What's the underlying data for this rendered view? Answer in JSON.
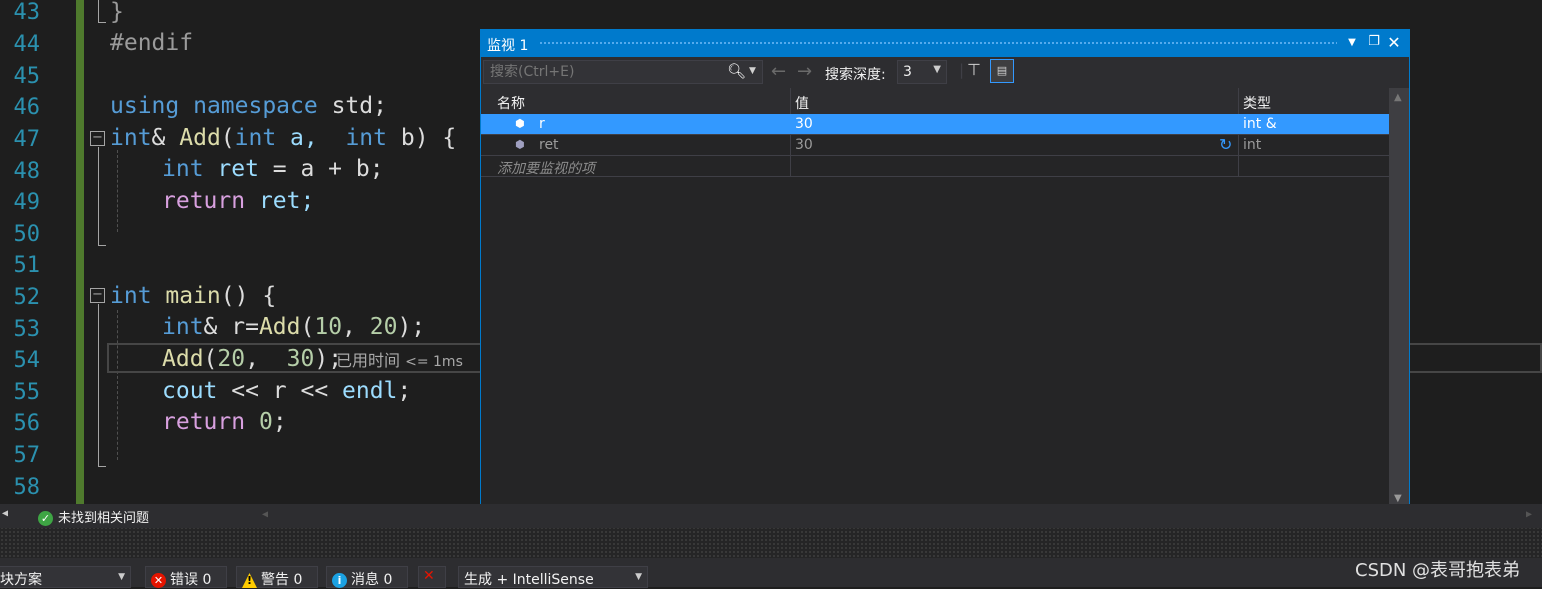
{
  "editor": {
    "line_numbers": [
      "43",
      "44",
      "45",
      "46",
      "47",
      "48",
      "49",
      "50",
      "51",
      "52",
      "53",
      "54",
      "55",
      "56",
      "57",
      "58"
    ],
    "lines": {
      "l43": "}",
      "l44": "#endif",
      "l46": [
        "using",
        " namespace ",
        "std",
        ";"
      ],
      "l47": [
        "int",
        "& ",
        "Add",
        "(",
        "int",
        " a,  ",
        "int",
        " b) {"
      ],
      "l48": [
        "int",
        " ret ",
        "= a + b;"
      ],
      "l49": [
        "return",
        " ret;"
      ],
      "l50": "}",
      "l52": [
        "int",
        " main",
        "() {"
      ],
      "l53": [
        "int",
        "& r=",
        "Add",
        "(",
        "10",
        ", ",
        "20",
        ");"
      ],
      "l54": [
        "Add",
        "(",
        "20",
        ",  ",
        "30",
        ");"
      ],
      "l55": [
        "cout",
        " << r << ",
        "endl",
        ";"
      ],
      "l56": [
        "return",
        " ",
        "0",
        ";"
      ],
      "l57": "}"
    },
    "elapsed_label": "已用时间",
    "elapsed_value": "<= 1ms"
  },
  "watch": {
    "title": "监视 1",
    "search_placeholder": "搜索(Ctrl+E)",
    "depth_label": "搜索深度:",
    "depth_value": "3",
    "columns": [
      "名称",
      "值",
      "类型"
    ],
    "rows": [
      {
        "name": "r",
        "value": "30",
        "type": "int &",
        "selected": true
      },
      {
        "name": "ret",
        "value": "30",
        "type": "int",
        "selected": false
      }
    ],
    "add_item_text": "添加要监视的项"
  },
  "status": {
    "no_issues": "未找到相关问题"
  },
  "errorlist": {
    "solution_label": "块方案",
    "errors": "错误 0",
    "warnings": "警告 0",
    "messages": "消息 0",
    "filter": "生成 + IntelliSense"
  },
  "watermark": "CSDN @表哥抱表弟",
  "colors": {
    "accent": "#007acc",
    "selection": "#3399ff",
    "editor_bg": "#1e1e1e"
  }
}
